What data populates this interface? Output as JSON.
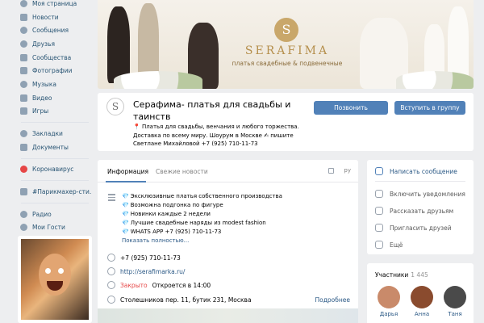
{
  "nav": {
    "items": [
      {
        "label": "Моя страница",
        "icon": "user-icon"
      },
      {
        "label": "Новости",
        "icon": "newspaper-icon"
      },
      {
        "label": "Сообщения",
        "icon": "chat-icon"
      },
      {
        "label": "Друзья",
        "icon": "friends-icon"
      },
      {
        "label": "Сообщества",
        "icon": "groups-icon"
      },
      {
        "label": "Фотографии",
        "icon": "photo-icon"
      },
      {
        "label": "Музыка",
        "icon": "music-icon"
      },
      {
        "label": "Видео",
        "icon": "video-icon"
      },
      {
        "label": "Игры",
        "icon": "gamepad-icon"
      },
      {
        "label": "Закладки",
        "icon": "star-icon"
      },
      {
        "label": "Документы",
        "icon": "document-icon"
      },
      {
        "label": "Коронавирус",
        "icon": "coronavirus-icon"
      },
      {
        "label": "#Парикмахер-сти...",
        "icon": "hashtag-icon"
      },
      {
        "label": "Радио",
        "icon": "radio-icon"
      },
      {
        "label": "Мои Гости",
        "icon": "guests-icon"
      }
    ]
  },
  "cover": {
    "logo_letter": "S",
    "brand": "SERAFIMA",
    "tagline": "платья свадебные & подвенечные"
  },
  "group": {
    "logo_letter": "S",
    "name": "Серафима- платья для свадьбы и таинств",
    "status_line1": "📍 Платья для свадьбы, венчания и любого торжества.",
    "status_line2": "Доставка по всему миру. Шоурум в Москве ✍ пишите",
    "status_line3": "Светлане Михайловой +7 (925) 710-11-73",
    "call_button": "Позвонить",
    "join_button": "Вступить в группу"
  },
  "info": {
    "tabs": {
      "info": "Информация",
      "news": "Свежие новости",
      "right": "ру"
    },
    "description": [
      "Эксклюзивные платья собственного производства",
      "Возможна подгонка по фигуре",
      "Новинки каждые 2 недели",
      "Лучшие свадебные наряды из modest fashion",
      "WHATS APP +7 (925) 710-11-73"
    ],
    "gem": "💎",
    "show_more": "Показать полностью...",
    "phone": "+7 (925) 710-11-73",
    "site": "http://serafimarka.ru/",
    "closed": "Закрыто",
    "opens": "Откроется в 14:00",
    "address": "Столешников пер. 11, бутик 231, Москва",
    "address_more": "Подробнее"
  },
  "actions": {
    "write": "Написать сообщение",
    "notify": "Включить уведомления",
    "tell": "Рассказать друзьям",
    "invite": "Пригласить друзей",
    "more": "Ещё"
  },
  "members": {
    "title": "Участники",
    "count": "1 445",
    "list": [
      {
        "name": "Дарья",
        "color": "#c98a6a"
      },
      {
        "name": "Анна",
        "color": "#8a4b2e"
      },
      {
        "name": "Таня",
        "color": "#4a4a4a"
      }
    ]
  }
}
